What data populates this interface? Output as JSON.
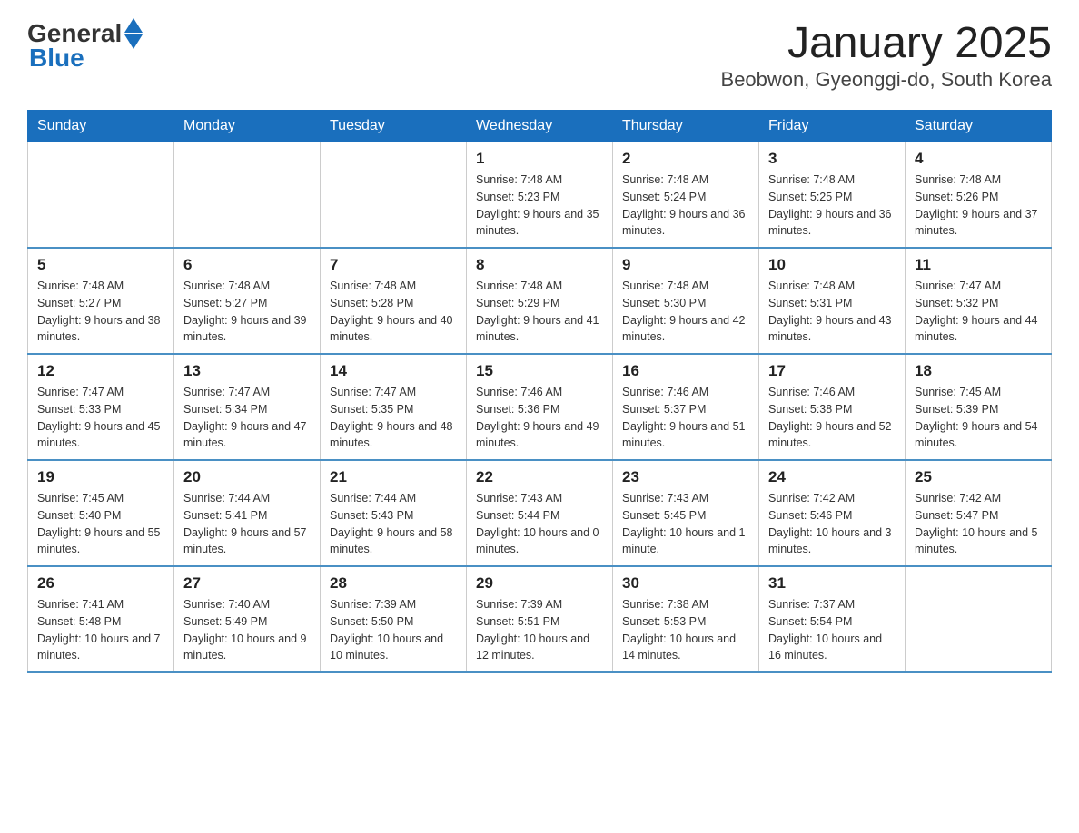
{
  "header": {
    "logo_general": "General",
    "logo_blue": "Blue",
    "title": "January 2025",
    "subtitle": "Beobwon, Gyeonggi-do, South Korea"
  },
  "weekdays": [
    "Sunday",
    "Monday",
    "Tuesday",
    "Wednesday",
    "Thursday",
    "Friday",
    "Saturday"
  ],
  "weeks": [
    [
      {
        "day": "",
        "info": ""
      },
      {
        "day": "",
        "info": ""
      },
      {
        "day": "",
        "info": ""
      },
      {
        "day": "1",
        "info": "Sunrise: 7:48 AM\nSunset: 5:23 PM\nDaylight: 9 hours and 35 minutes."
      },
      {
        "day": "2",
        "info": "Sunrise: 7:48 AM\nSunset: 5:24 PM\nDaylight: 9 hours and 36 minutes."
      },
      {
        "day": "3",
        "info": "Sunrise: 7:48 AM\nSunset: 5:25 PM\nDaylight: 9 hours and 36 minutes."
      },
      {
        "day": "4",
        "info": "Sunrise: 7:48 AM\nSunset: 5:26 PM\nDaylight: 9 hours and 37 minutes."
      }
    ],
    [
      {
        "day": "5",
        "info": "Sunrise: 7:48 AM\nSunset: 5:27 PM\nDaylight: 9 hours and 38 minutes."
      },
      {
        "day": "6",
        "info": "Sunrise: 7:48 AM\nSunset: 5:27 PM\nDaylight: 9 hours and 39 minutes."
      },
      {
        "day": "7",
        "info": "Sunrise: 7:48 AM\nSunset: 5:28 PM\nDaylight: 9 hours and 40 minutes."
      },
      {
        "day": "8",
        "info": "Sunrise: 7:48 AM\nSunset: 5:29 PM\nDaylight: 9 hours and 41 minutes."
      },
      {
        "day": "9",
        "info": "Sunrise: 7:48 AM\nSunset: 5:30 PM\nDaylight: 9 hours and 42 minutes."
      },
      {
        "day": "10",
        "info": "Sunrise: 7:48 AM\nSunset: 5:31 PM\nDaylight: 9 hours and 43 minutes."
      },
      {
        "day": "11",
        "info": "Sunrise: 7:47 AM\nSunset: 5:32 PM\nDaylight: 9 hours and 44 minutes."
      }
    ],
    [
      {
        "day": "12",
        "info": "Sunrise: 7:47 AM\nSunset: 5:33 PM\nDaylight: 9 hours and 45 minutes."
      },
      {
        "day": "13",
        "info": "Sunrise: 7:47 AM\nSunset: 5:34 PM\nDaylight: 9 hours and 47 minutes."
      },
      {
        "day": "14",
        "info": "Sunrise: 7:47 AM\nSunset: 5:35 PM\nDaylight: 9 hours and 48 minutes."
      },
      {
        "day": "15",
        "info": "Sunrise: 7:46 AM\nSunset: 5:36 PM\nDaylight: 9 hours and 49 minutes."
      },
      {
        "day": "16",
        "info": "Sunrise: 7:46 AM\nSunset: 5:37 PM\nDaylight: 9 hours and 51 minutes."
      },
      {
        "day": "17",
        "info": "Sunrise: 7:46 AM\nSunset: 5:38 PM\nDaylight: 9 hours and 52 minutes."
      },
      {
        "day": "18",
        "info": "Sunrise: 7:45 AM\nSunset: 5:39 PM\nDaylight: 9 hours and 54 minutes."
      }
    ],
    [
      {
        "day": "19",
        "info": "Sunrise: 7:45 AM\nSunset: 5:40 PM\nDaylight: 9 hours and 55 minutes."
      },
      {
        "day": "20",
        "info": "Sunrise: 7:44 AM\nSunset: 5:41 PM\nDaylight: 9 hours and 57 minutes."
      },
      {
        "day": "21",
        "info": "Sunrise: 7:44 AM\nSunset: 5:43 PM\nDaylight: 9 hours and 58 minutes."
      },
      {
        "day": "22",
        "info": "Sunrise: 7:43 AM\nSunset: 5:44 PM\nDaylight: 10 hours and 0 minutes."
      },
      {
        "day": "23",
        "info": "Sunrise: 7:43 AM\nSunset: 5:45 PM\nDaylight: 10 hours and 1 minute."
      },
      {
        "day": "24",
        "info": "Sunrise: 7:42 AM\nSunset: 5:46 PM\nDaylight: 10 hours and 3 minutes."
      },
      {
        "day": "25",
        "info": "Sunrise: 7:42 AM\nSunset: 5:47 PM\nDaylight: 10 hours and 5 minutes."
      }
    ],
    [
      {
        "day": "26",
        "info": "Sunrise: 7:41 AM\nSunset: 5:48 PM\nDaylight: 10 hours and 7 minutes."
      },
      {
        "day": "27",
        "info": "Sunrise: 7:40 AM\nSunset: 5:49 PM\nDaylight: 10 hours and 9 minutes."
      },
      {
        "day": "28",
        "info": "Sunrise: 7:39 AM\nSunset: 5:50 PM\nDaylight: 10 hours and 10 minutes."
      },
      {
        "day": "29",
        "info": "Sunrise: 7:39 AM\nSunset: 5:51 PM\nDaylight: 10 hours and 12 minutes."
      },
      {
        "day": "30",
        "info": "Sunrise: 7:38 AM\nSunset: 5:53 PM\nDaylight: 10 hours and 14 minutes."
      },
      {
        "day": "31",
        "info": "Sunrise: 7:37 AM\nSunset: 5:54 PM\nDaylight: 10 hours and 16 minutes."
      },
      {
        "day": "",
        "info": ""
      }
    ]
  ]
}
